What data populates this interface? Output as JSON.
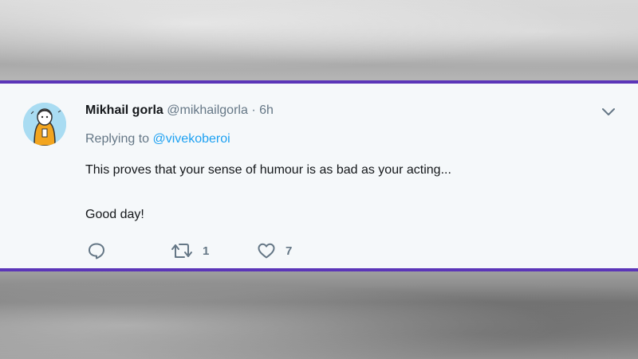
{
  "tweet": {
    "display_name": "Mikhail gorla",
    "handle": "@mikhailgorla",
    "separator": "·",
    "time": "6h",
    "replying_prefix": "Replying to",
    "replying_to": "@vivekoberoi",
    "text_line1": "This proves that your sense of humour is as bad as your acting...",
    "text_line2": "Good day!",
    "retweet_count": "1",
    "like_count": "7"
  },
  "colors": {
    "accent_border": "#5b35b8",
    "link": "#1da1f2",
    "muted": "#657786",
    "text": "#14171a",
    "card_bg": "#f5f8fa"
  },
  "icons": {
    "caret": "chevron-down-icon",
    "reply": "reply-icon",
    "retweet": "retweet-icon",
    "like": "heart-icon",
    "avatar": "avatar"
  }
}
